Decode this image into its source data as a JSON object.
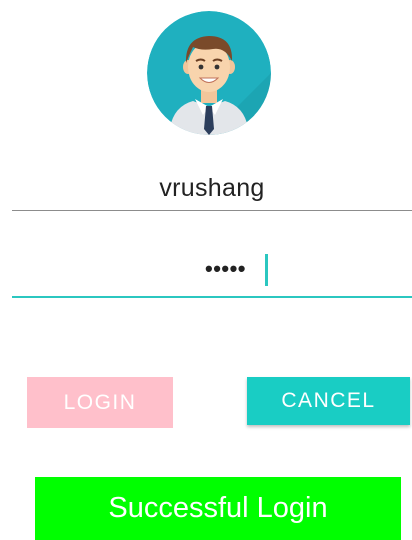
{
  "avatar": {
    "icon": "user-avatar-icon",
    "background_color": "#1fb0bf"
  },
  "username": {
    "value": "vrushang"
  },
  "password": {
    "masked_value": "•••••",
    "accent_color": "#2bc7c0"
  },
  "buttons": {
    "login_label": "LOGIN",
    "login_color": "#ffc0cb",
    "cancel_label": "CANCEL",
    "cancel_color": "#19cdc4"
  },
  "status": {
    "message": "Successful Login",
    "color": "#00ff00"
  }
}
